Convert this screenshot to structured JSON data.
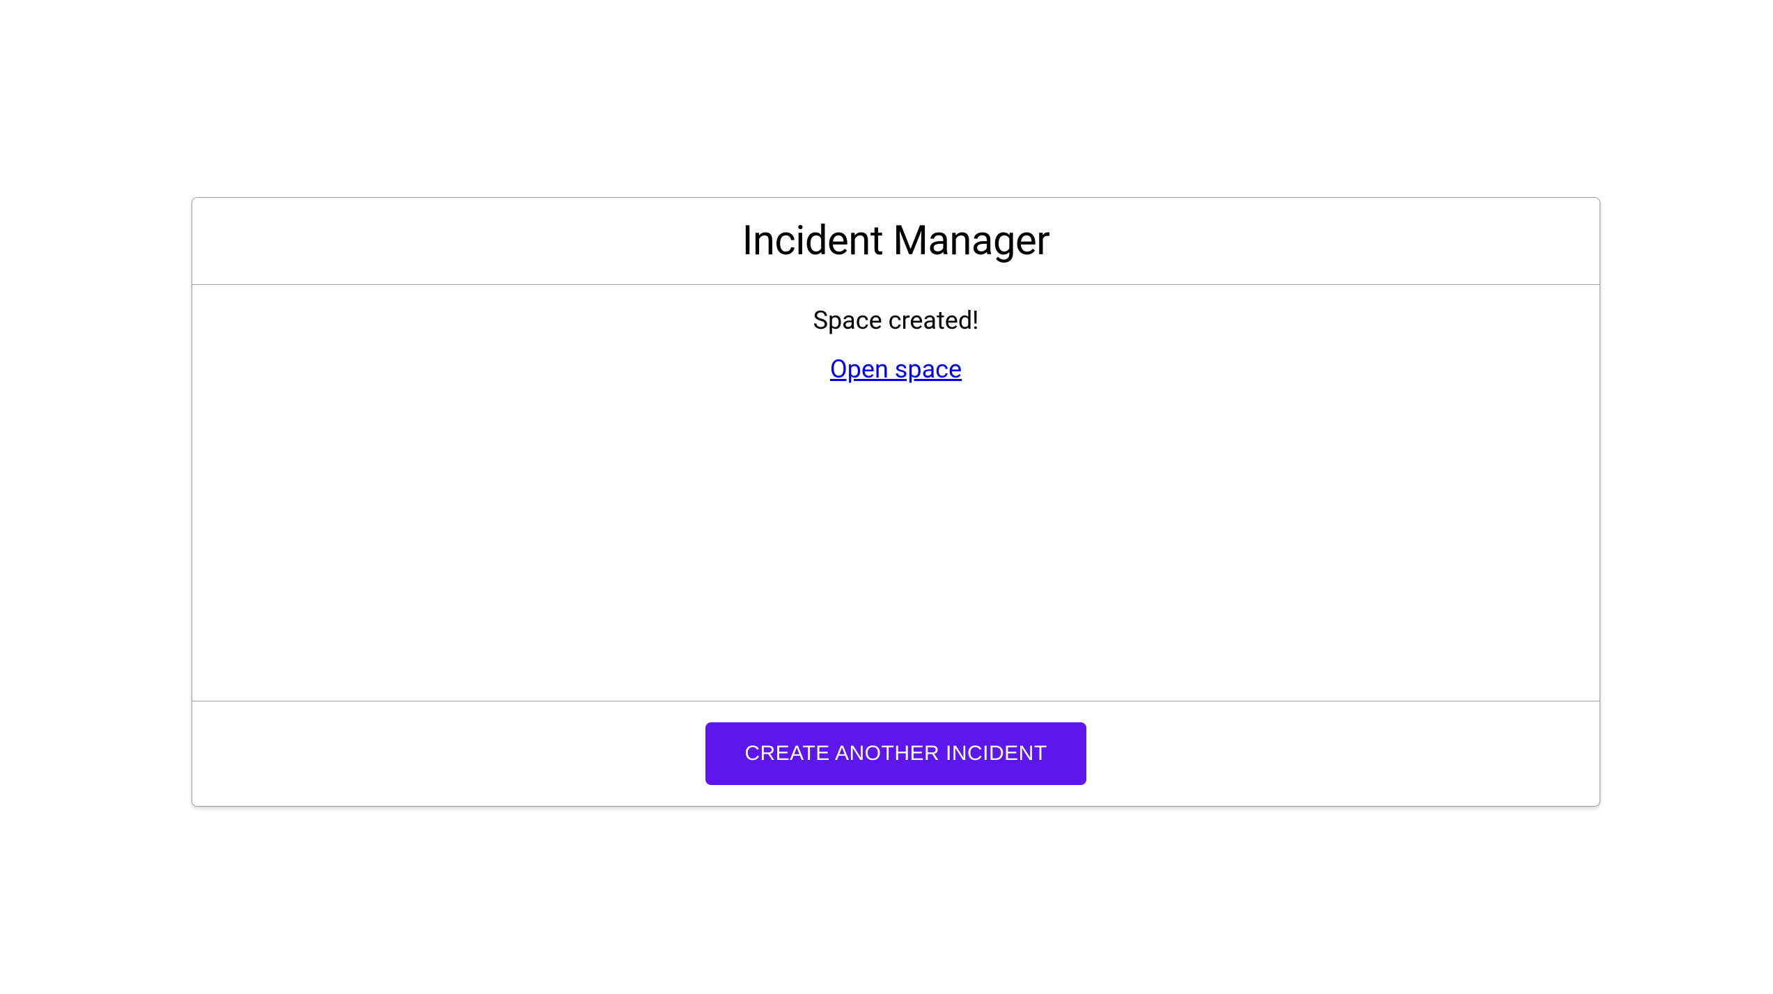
{
  "card": {
    "title": "Incident Manager",
    "status_message": "Space created!",
    "link_label": "Open space",
    "button_label": "CREATE ANOTHER INCIDENT"
  },
  "colors": {
    "primary": "#5e17eb",
    "border": "#9e9e9e",
    "link": "#0000ee"
  }
}
